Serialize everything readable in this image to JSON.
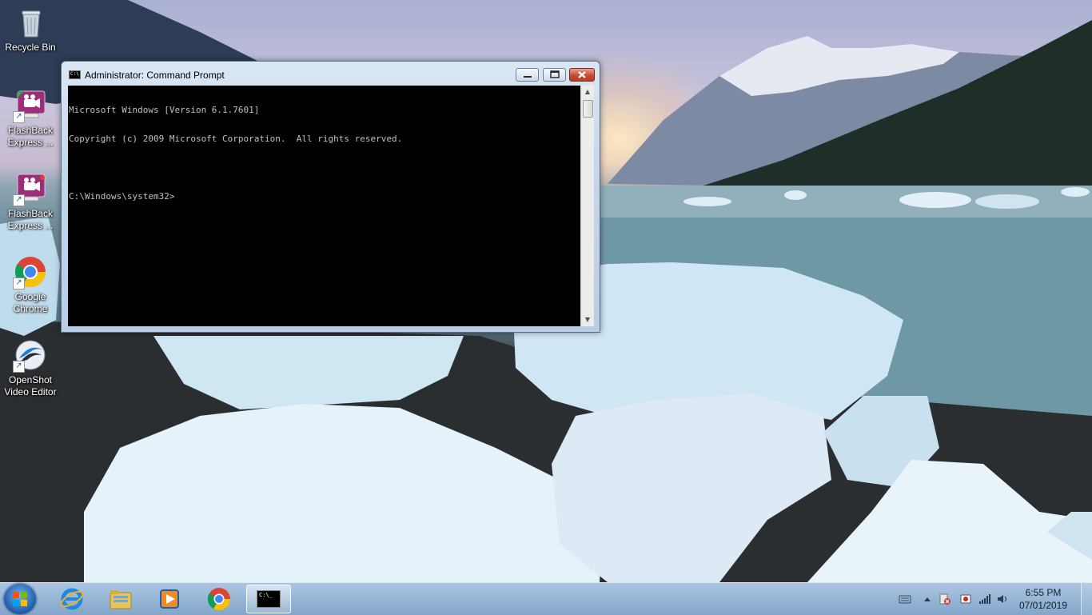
{
  "desktop": {
    "icons": [
      {
        "label": "Recycle Bin",
        "icon": "recycle-bin-icon"
      },
      {
        "label": "FlashBack Express ...",
        "icon": "flashback-express-icon"
      },
      {
        "label": "FlashBack Express ...",
        "icon": "flashback-express-icon"
      },
      {
        "label": "Google Chrome",
        "icon": "chrome-icon"
      },
      {
        "label": "OpenShot Video Editor",
        "icon": "openshot-icon"
      }
    ]
  },
  "cmd": {
    "title": "Administrator: Command Prompt",
    "icon_text": "C:\\",
    "lines": [
      "Microsoft Windows [Version 6.1.7601]",
      "Copyright (c) 2009 Microsoft Corporation.  All rights reserved.",
      "",
      "C:\\Windows\\system32>"
    ],
    "buttons": {
      "minimize": "▭",
      "maximize": "▢",
      "close": "✕"
    }
  },
  "taskbar": {
    "items": [
      "start-button",
      "internet-explorer",
      "windows-explorer",
      "media-player",
      "google-chrome",
      "command-prompt"
    ],
    "active": "command-prompt",
    "cmd_glyph_text": "C:\\_",
    "tray": [
      "keyboard-icon",
      "show-hidden-icons",
      "action-center-icon",
      "flashback-recorder-icon",
      "network-signal-icon",
      "volume-icon"
    ],
    "time": "6:55 PM",
    "date": "07/01/2019"
  },
  "colors": {
    "console_bg": "#000000",
    "console_text": "#c0c0c0",
    "close_button": "#c74b34",
    "taskbar": "#a8c4e0"
  }
}
